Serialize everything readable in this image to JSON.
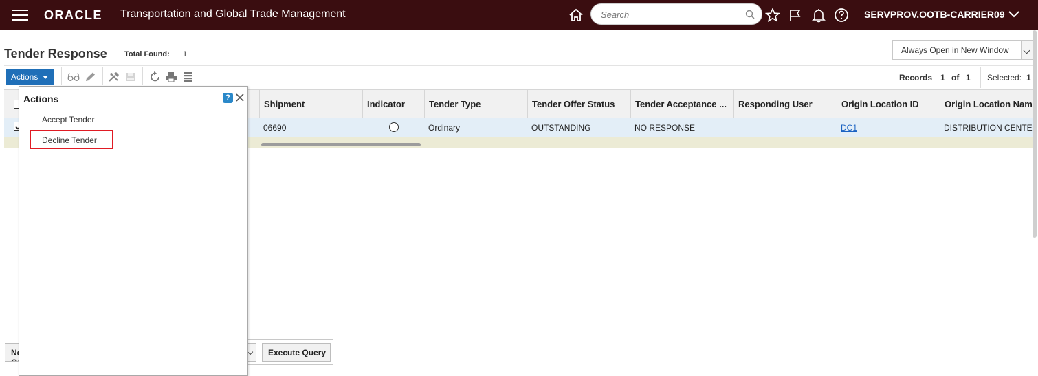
{
  "topbar": {
    "brand": "ORACLE",
    "app_title": "Transportation and Global Trade Management",
    "search_placeholder": "Search",
    "user": "SERVPROV.OOTB-CARRIER09"
  },
  "page": {
    "title": "Tender Response",
    "total_found_label": "Total Found:",
    "total_found_value": "1",
    "open_window_option": "Always Open in New Window"
  },
  "toolbar": {
    "actions_label": "Actions",
    "records_label": "Records",
    "records_current": "1",
    "records_of": "of",
    "records_total": "1",
    "selected_label": "Selected:",
    "selected_value": "1"
  },
  "grid": {
    "columns": [
      "Shipment",
      "Indicator",
      "Tender Type",
      "Tender Offer Status",
      "Tender Acceptance ...",
      "Responding User",
      "Origin Location ID",
      "Origin Location Name"
    ],
    "rows": [
      {
        "shipment": "06690",
        "indicator": "",
        "tender_type": "Ordinary",
        "tender_offer_status": "OUTSTANDING",
        "tender_acceptance": "NO RESPONSE",
        "responding_user": "",
        "origin_location_id": "DC1",
        "origin_location_name": "DISTRIBUTION CENTER"
      }
    ]
  },
  "popup": {
    "title": "Actions",
    "help": "?",
    "items": [
      "Accept Tender",
      "Decline Tender"
    ]
  },
  "bottom": {
    "new_label": "New Query",
    "execute_label": "Execute Query"
  },
  "colors": {
    "topbar_bg": "#3a0d10",
    "accent_blue": "#1f6fb8",
    "row_selected": "#e3eef7",
    "highlight_red": "#e01b24"
  }
}
